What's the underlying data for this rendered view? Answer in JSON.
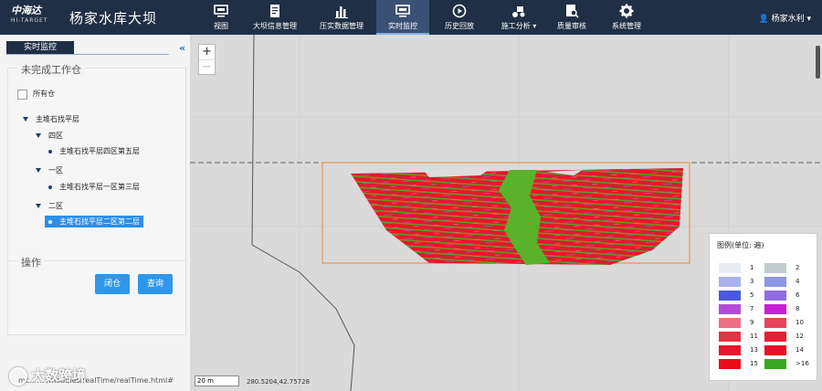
{
  "header": {
    "logo_main": "中海达",
    "logo_sub": "HI-TARGET",
    "app_title": "杨家水库大坝",
    "nav": [
      {
        "label": "视图",
        "icon": "monitor-icon"
      },
      {
        "label": "大坝信息管理",
        "icon": "document-icon"
      },
      {
        "label": "压实数据管理",
        "icon": "bar-chart-icon"
      },
      {
        "label": "实时监控",
        "icon": "monitor-icon"
      },
      {
        "label": "历史回放",
        "icon": "play-icon"
      },
      {
        "label": "施工分析",
        "icon": "roller-icon"
      },
      {
        "label": "质量审核",
        "icon": "report-icon"
      },
      {
        "label": "系统管理",
        "icon": "gear-icon"
      }
    ],
    "active_nav": "实时监控",
    "user": "杨家水利"
  },
  "sidebar": {
    "tab": "实时监控",
    "collapse": "«",
    "unfinished_title": "未完成工作仓",
    "all_label": "所有仓",
    "tree": {
      "root": "主堆石找平层",
      "sections": [
        {
          "label": "四区",
          "items": [
            "主堆石找平层四区第五层"
          ]
        },
        {
          "label": "一区",
          "items": [
            "主堆石找平层一区第三层"
          ]
        },
        {
          "label": "二区",
          "items": [
            "主堆石找平层二区第二层"
          ]
        }
      ]
    },
    "ops_title": "操作",
    "close_button": "闭仓",
    "query_button": "查询",
    "status_url": "mc…… /modules/realTime/realTime.html#",
    "watermark": "大数跨境"
  },
  "map": {
    "zoom_in": "+",
    "zoom_out": "−",
    "scale_label": "20 m",
    "coords": "280.5204,42.75728"
  },
  "legend": {
    "title": "图例(单位: 遍)",
    "entries": [
      {
        "label": "1",
        "color": "#e6eef3"
      },
      {
        "label": "2",
        "color": "#c2cccf"
      },
      {
        "label": "3",
        "color": "#a9b1ef"
      },
      {
        "label": "4",
        "color": "#8c97ea"
      },
      {
        "label": "5",
        "color": "#4a59e0"
      },
      {
        "label": "6",
        "color": "#8f6ee0"
      },
      {
        "label": "7",
        "color": "#b44bd8"
      },
      {
        "label": "8",
        "color": "#c81fd5"
      },
      {
        "label": "9",
        "color": "#ee6f84"
      },
      {
        "label": "10",
        "color": "#e8455c"
      },
      {
        "label": "11",
        "color": "#e63346"
      },
      {
        "label": "12",
        "color": "#e81d36"
      },
      {
        "label": "13",
        "color": "#e8152b"
      },
      {
        "label": "14",
        "color": "#e8102a"
      },
      {
        "label": "15",
        "color": "#ea0b1c"
      },
      {
        "label": ">16",
        "color": "#3aa622"
      }
    ]
  }
}
